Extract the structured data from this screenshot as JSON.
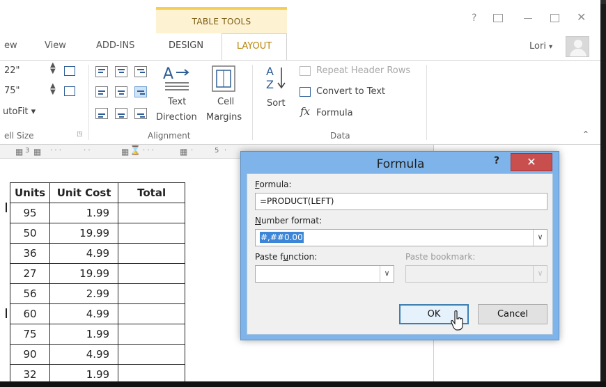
{
  "titlebar": {
    "contextual_group": "TABLE TOOLS",
    "window_controls": [
      "?",
      "restore-ribbon",
      "minimize",
      "maximize",
      "close"
    ]
  },
  "tabs": {
    "partial_left": "ew",
    "items": [
      "View",
      "ADD-INS",
      "DESIGN",
      "LAYOUT"
    ],
    "active": "LAYOUT"
  },
  "account": {
    "user_name": "Lori",
    "caret": "▾"
  },
  "ribbon": {
    "cell_size": {
      "height_value": "22\"",
      "width_value": "75\"",
      "autofit_label": "utoFit ▾",
      "group_label": "ell Size"
    },
    "alignment": {
      "text_direction_label_1": "Text",
      "text_direction_label_2": "Direction",
      "cell_margins_label_1": "Cell",
      "cell_margins_label_2": "Margins",
      "group_label": "Alignment"
    },
    "data": {
      "sort_label": "Sort",
      "repeat_header_rows": "Repeat Header Rows",
      "convert_to_text": "Convert to Text",
      "formula_label": "Formula",
      "formula_glyph": "fx",
      "group_label": "Data"
    }
  },
  "ruler": {
    "marks": [
      "3",
      "5"
    ]
  },
  "table": {
    "headers": [
      "Units",
      "Unit Cost",
      "Total"
    ],
    "rows": [
      {
        "units": "95",
        "cost": "1.99",
        "total": ""
      },
      {
        "units": "50",
        "cost": "19.99",
        "total": ""
      },
      {
        "units": "36",
        "cost": "4.99",
        "total": ""
      },
      {
        "units": "27",
        "cost": "19.99",
        "total": ""
      },
      {
        "units": "56",
        "cost": "2.99",
        "total": ""
      },
      {
        "units": "60",
        "cost": "4.99",
        "total": ""
      },
      {
        "units": "75",
        "cost": "1.99",
        "total": ""
      },
      {
        "units": "90",
        "cost": "4.99",
        "total": ""
      },
      {
        "units": "32",
        "cost": "1.99",
        "total": ""
      }
    ]
  },
  "dialog": {
    "title": "Formula",
    "help": "?",
    "close": "✕",
    "formula_label_first": "F",
    "formula_label_rest": "ormula:",
    "formula_value": "=PRODUCT(LEFT)",
    "number_format_label_first": "N",
    "number_format_label_rest": "umber format:",
    "number_format_value": "#,##0.00",
    "paste_function_label_a": "Paste f",
    "paste_function_label_u": "u",
    "paste_function_label_b": "nction:",
    "paste_function_value": "",
    "paste_bookmark_label": "Paste bookmark:",
    "paste_bookmark_value": "",
    "ok_label": "OK",
    "cancel_label": "Cancel",
    "dropdown_glyph": "∨"
  },
  "colors": {
    "tabletools_band": "#fdf3d3",
    "active_tab_text": "#b8860b",
    "dialog_frame": "#7eb4ea",
    "close_button": "#c94f4f",
    "selection": "#3d85d6"
  }
}
